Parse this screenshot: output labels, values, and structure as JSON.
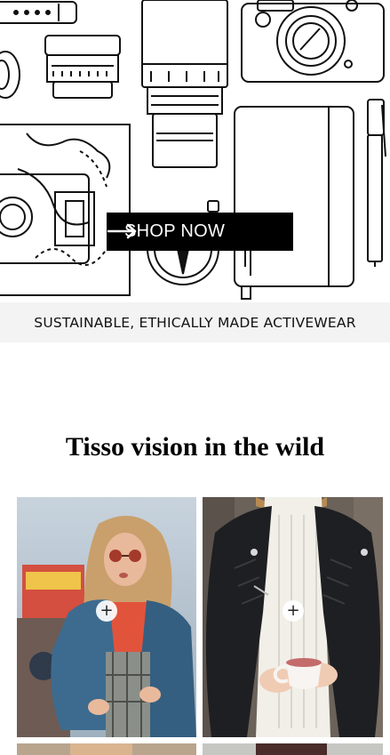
{
  "hero": {
    "cta_label": "SHOP NOW",
    "arrow_icon": "arrow-right-icon",
    "illustration": "travel-items-line-drawing"
  },
  "banner": {
    "text": "SUSTAINABLE, ETHICALLY MADE ACTIVEWEAR"
  },
  "gallery": {
    "title": "Tisso vision in the wild",
    "add_icon": "plus-icon",
    "plus_symbol": "+",
    "items": [
      {
        "subject": "woman-denim-jacket-sunglasses"
      },
      {
        "subject": "leather-jacket-holding-cup"
      },
      {
        "subject": "partial-photo"
      },
      {
        "subject": "partial-photo"
      }
    ]
  },
  "colors": {
    "cta_background": "#000000",
    "cta_text": "#ffffff",
    "banner_background": "#f3f3f3",
    "page_background": "#ffffff"
  }
}
